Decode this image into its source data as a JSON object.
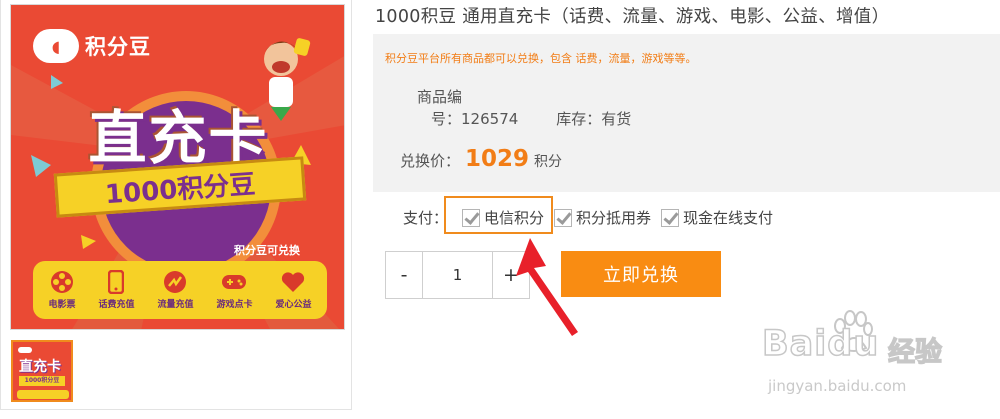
{
  "product": {
    "title": "1000积豆 通用直充卡（话费、流量、游戏、电影、公益、增值）",
    "promo_text": "积分豆平台所有商品都可以兑换，包含 话费，流量，游戏等等。",
    "sku_label": "商品编",
    "sku_suffix": "号：",
    "sku_value": "126574",
    "stock_label": "库存：",
    "stock_value": "有货",
    "price_label": "兑换价：",
    "price_value": "1029",
    "price_unit": "积分"
  },
  "image": {
    "logo_text": "积分豆",
    "headline": "直充卡",
    "ribbon": "1000积分豆",
    "redeem_note": "积分豆可兑换",
    "band_items": [
      {
        "label": "电影票",
        "icon": "film-reel-icon"
      },
      {
        "label": "话费充值",
        "icon": "phone-icon"
      },
      {
        "label": "流量充值",
        "icon": "signal-icon"
      },
      {
        "label": "游戏点卡",
        "icon": "gamepad-icon"
      },
      {
        "label": "爱心公益",
        "icon": "heart-icon"
      }
    ],
    "thumb_headline": "直充卡",
    "thumb_ribbon": "1000积分豆"
  },
  "payment": {
    "label": "支付：",
    "options": [
      {
        "label": "电信积分",
        "checked": true,
        "highlighted": true
      },
      {
        "label": "积分抵用券",
        "checked": true,
        "highlighted": false
      },
      {
        "label": "现金在线支付",
        "checked": true,
        "highlighted": false
      }
    ]
  },
  "quantity": {
    "minus": "-",
    "value": "1",
    "plus": "+"
  },
  "actions": {
    "redeem_button": "立即兑换"
  },
  "watermark": {
    "logo": "Baidu",
    "logo_cn": "经验",
    "url": "jingyan.baidu.com"
  },
  "colors": {
    "accent_orange": "#f98c12",
    "price_orange": "#f27d16",
    "highlight_border": "#f08b1d",
    "arrow_red": "#e8202a",
    "poster_red": "#ea4a34",
    "poster_yellow": "#f6d126",
    "poster_purple": "#7b2f8e"
  }
}
